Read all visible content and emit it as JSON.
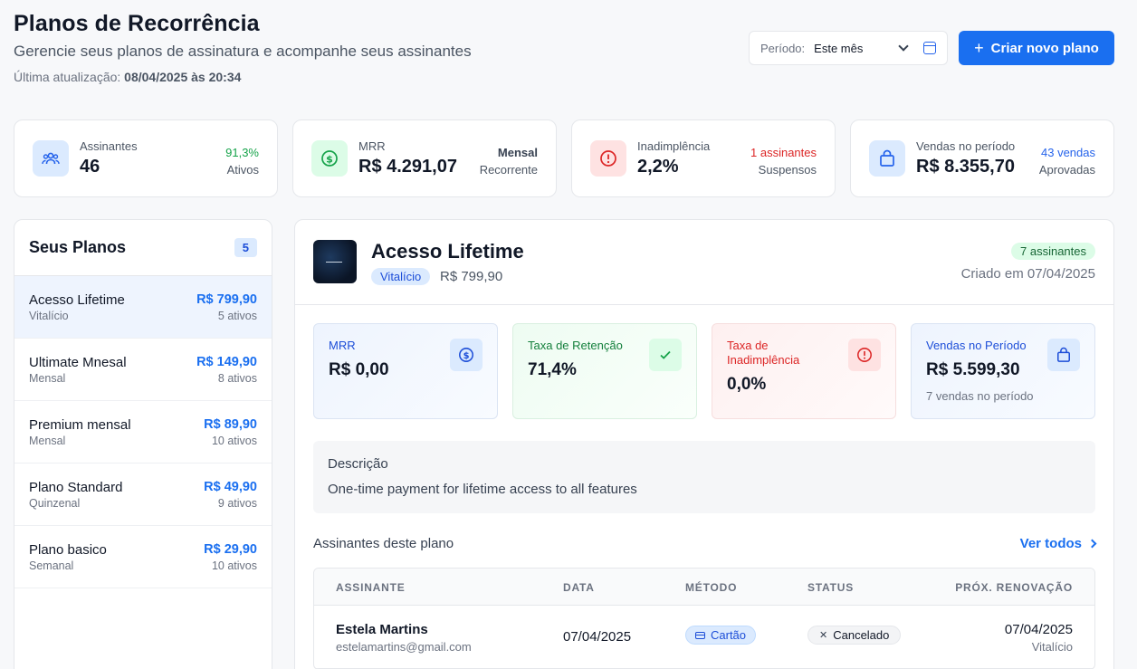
{
  "header": {
    "title": "Planos de Recorrência",
    "subtitle": "Gerencie seus planos de assinatura e acompanhe seus assinantes",
    "last_update_label": "Última atualização:",
    "last_update_value": "08/04/2025 às 20:34"
  },
  "period": {
    "label": "Período:",
    "value": "Este mês",
    "icon": "calendar-icon"
  },
  "create_button": {
    "icon": "plus-icon",
    "label": "Criar novo plano"
  },
  "stats": [
    {
      "label": "Assinantes",
      "value": "46",
      "right_top": "91,3%",
      "right_bottom": "Ativos",
      "icon": "users-icon",
      "accent": "#16a34a",
      "icon_bg": "#dbeafe",
      "icon_color": "#2563eb"
    },
    {
      "label": "MRR",
      "value": "R$ 4.291,07",
      "right_top": "Mensal",
      "right_bottom": "Recorrente",
      "icon": "dollar-icon",
      "accent": "#374151",
      "icon_bg": "#dcfce7",
      "icon_color": "#16a34a"
    },
    {
      "label": "Inadimplência",
      "value": "2,2%",
      "right_top": "1 assinantes",
      "right_bottom": "Suspensos",
      "icon": "alert-icon",
      "accent": "#dc2626",
      "icon_bg": "#fee2e2",
      "icon_color": "#dc2626"
    },
    {
      "label": "Vendas no período",
      "value": "R$ 8.355,70",
      "right_top": "43 vendas",
      "right_bottom": "Aprovadas",
      "icon": "bag-icon",
      "accent": "#2563eb",
      "icon_bg": "#dbeafe",
      "icon_color": "#2563eb"
    }
  ],
  "plans": {
    "title": "Seus Planos",
    "count": "5",
    "items": [
      {
        "name": "Acesso Lifetime",
        "freq": "Vitalício",
        "price": "R$ 799,90",
        "active": "5 ativos"
      },
      {
        "name": "Ultimate Mnesal",
        "freq": "Mensal",
        "price": "R$ 149,90",
        "active": "8 ativos"
      },
      {
        "name": "Premium mensal",
        "freq": "Mensal",
        "price": "R$ 89,90",
        "active": "10 ativos"
      },
      {
        "name": "Plano Standard",
        "freq": "Quinzenal",
        "price": "R$ 49,90",
        "active": "9 ativos"
      },
      {
        "name": "Plano basico",
        "freq": "Semanal",
        "price": "R$ 29,90",
        "active": "10 ativos"
      }
    ]
  },
  "detail": {
    "name": "Acesso Lifetime",
    "type": "Vitalício",
    "price": "R$ 799,90",
    "subscribers_badge": "7 assinantes",
    "created": "Criado em 07/04/2025",
    "metrics": [
      {
        "label": "MRR",
        "value": "R$ 0,00",
        "sub": "",
        "icon": "dollar-icon"
      },
      {
        "label": "Taxa de Retenção",
        "value": "71,4%",
        "sub": "",
        "icon": "check-icon"
      },
      {
        "label": "Taxa de Inadimplência",
        "value": "0,0%",
        "sub": "",
        "icon": "alert-icon"
      },
      {
        "label": "Vendas no Período",
        "value": "R$ 5.599,30",
        "sub": "7 vendas no período",
        "icon": "bag-icon"
      }
    ],
    "description_label": "Descrição",
    "description": "One-time payment for lifetime access to all features",
    "subscribers_title": "Assinantes deste plano",
    "see_all": "Ver todos",
    "table": {
      "headers": [
        "ASSINANTE",
        "DATA",
        "MÉTODO",
        "STATUS",
        "PRÓX. RENOVAÇÃO"
      ],
      "rows": [
        {
          "name": "Estela Martins",
          "email": "estelamartins@gmail.com",
          "date": "07/04/2025",
          "method": "Cartão",
          "status": "Cancelado",
          "renew_date": "07/04/2025",
          "renew_type": "Vitalício"
        }
      ]
    }
  }
}
